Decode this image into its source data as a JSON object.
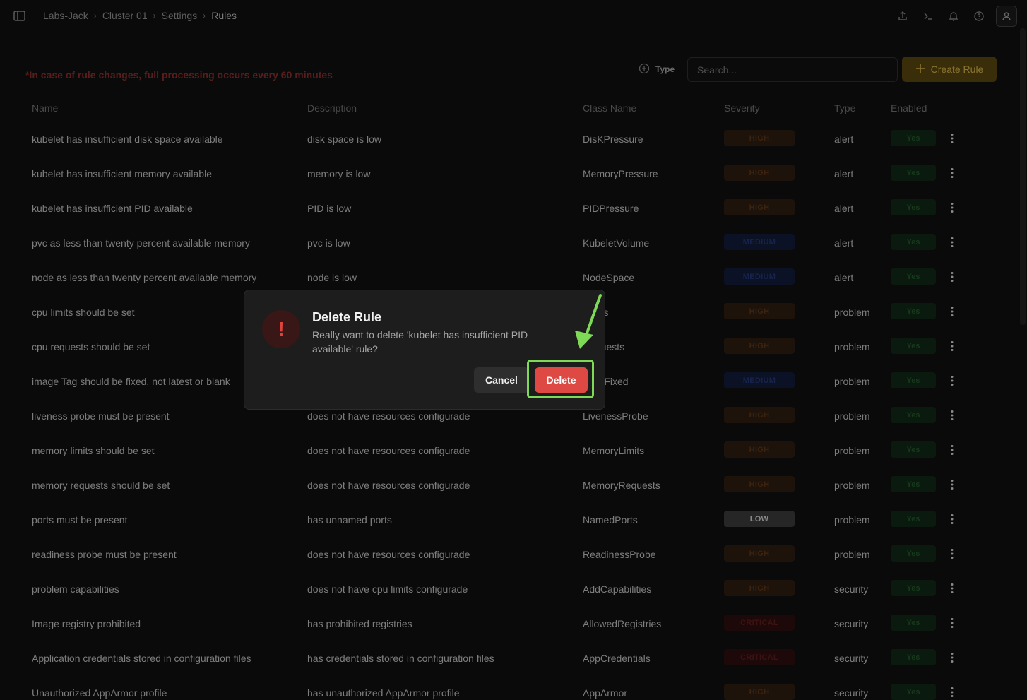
{
  "breadcrumb": [
    "Labs-Jack",
    "Cluster 01",
    "Settings",
    "Rules"
  ],
  "notice": "*In case of rule changes, full processing occurs every 60 minutes",
  "toolbar": {
    "type_filter_label": "Type",
    "search_placeholder": "Search...",
    "create_label": "Create Rule"
  },
  "table": {
    "headers": {
      "name": "Name",
      "description": "Description",
      "class": "Class Name",
      "severity": "Severity",
      "type": "Type",
      "enabled": "Enabled"
    },
    "rows": [
      {
        "name": "kubelet has insufficient disk space available",
        "description": "disk space is low",
        "class": "DisKPressure",
        "severity": "HIGH",
        "type": "alert",
        "enabled": "Yes"
      },
      {
        "name": "kubelet has insufficient memory available",
        "description": "memory is low",
        "class": "MemoryPressure",
        "severity": "HIGH",
        "type": "alert",
        "enabled": "Yes"
      },
      {
        "name": "kubelet has insufficient PID available",
        "description": "PID is low",
        "class": "PIDPressure",
        "severity": "HIGH",
        "type": "alert",
        "enabled": "Yes"
      },
      {
        "name": "pvc as less than twenty percent available memory",
        "description": "pvc is low",
        "class": "KubeletVolume",
        "severity": "MEDIUM",
        "type": "alert",
        "enabled": "Yes"
      },
      {
        "name": "node as less than twenty percent available memory",
        "description": "node is low",
        "class": "NodeSpace",
        "severity": "MEDIUM",
        "type": "alert",
        "enabled": "Yes"
      },
      {
        "name": "cpu limits should be set",
        "description": "",
        "class": "Limits",
        "severity": "HIGH",
        "type": "problem",
        "enabled": "Yes"
      },
      {
        "name": "cpu requests should be set",
        "description": "",
        "class": "Requests",
        "severity": "HIGH",
        "type": "problem",
        "enabled": "Yes"
      },
      {
        "name": "image Tag should be fixed. not latest or blank",
        "description": "",
        "class": "eTagFixed",
        "severity": "MEDIUM",
        "type": "problem",
        "enabled": "Yes"
      },
      {
        "name": "liveness probe must be present",
        "description": "does not have resources configurade",
        "class": "LivenessProbe",
        "severity": "HIGH",
        "type": "problem",
        "enabled": "Yes"
      },
      {
        "name": "memory limits should be set",
        "description": "does not have resources configurade",
        "class": "MemoryLimits",
        "severity": "HIGH",
        "type": "problem",
        "enabled": "Yes"
      },
      {
        "name": "memory requests should be set",
        "description": "does not have resources configurade",
        "class": "MemoryRequests",
        "severity": "HIGH",
        "type": "problem",
        "enabled": "Yes"
      },
      {
        "name": "ports must be present",
        "description": "has unnamed ports",
        "class": "NamedPorts",
        "severity": "LOW",
        "type": "problem",
        "enabled": "Yes"
      },
      {
        "name": "readiness probe must be present",
        "description": "does not have resources configurade",
        "class": "ReadinessProbe",
        "severity": "HIGH",
        "type": "problem",
        "enabled": "Yes"
      },
      {
        "name": "problem capabilities",
        "description": "does not have cpu limits configurade",
        "class": "AddCapabilities",
        "severity": "HIGH",
        "type": "security",
        "enabled": "Yes"
      },
      {
        "name": "Image registry prohibited",
        "description": "has prohibited registries",
        "class": "AllowedRegistries",
        "severity": "CRITICAL",
        "type": "security",
        "enabled": "Yes"
      },
      {
        "name": "Application credentials stored in configuration files",
        "description": "has credentials stored in configuration files",
        "class": "AppCredentials",
        "severity": "CRITICAL",
        "type": "security",
        "enabled": "Yes"
      },
      {
        "name": "Unauthorized AppArmor profile",
        "description": "has unauthorized AppArmor profile",
        "class": "AppArmor",
        "severity": "HIGH",
        "type": "security",
        "enabled": "Yes"
      }
    ]
  },
  "dialog": {
    "icon": "!",
    "title": "Delete Rule",
    "message": "Really want to delete 'kubelet has insufficient PID available' rule?",
    "cancel_label": "Cancel",
    "delete_label": "Delete"
  },
  "colors": {
    "danger": "#de4a43",
    "highlight": "#7ed957",
    "create_button": "#3a2e0a"
  },
  "icons": [
    "sidebar-toggle-icon",
    "share-icon",
    "terminal-icon",
    "bell-icon",
    "help-icon",
    "user-icon",
    "plus-circle-icon",
    "plus-icon",
    "kebab-menu-icon",
    "warning-icon",
    "pointer-arrow-icon"
  ]
}
